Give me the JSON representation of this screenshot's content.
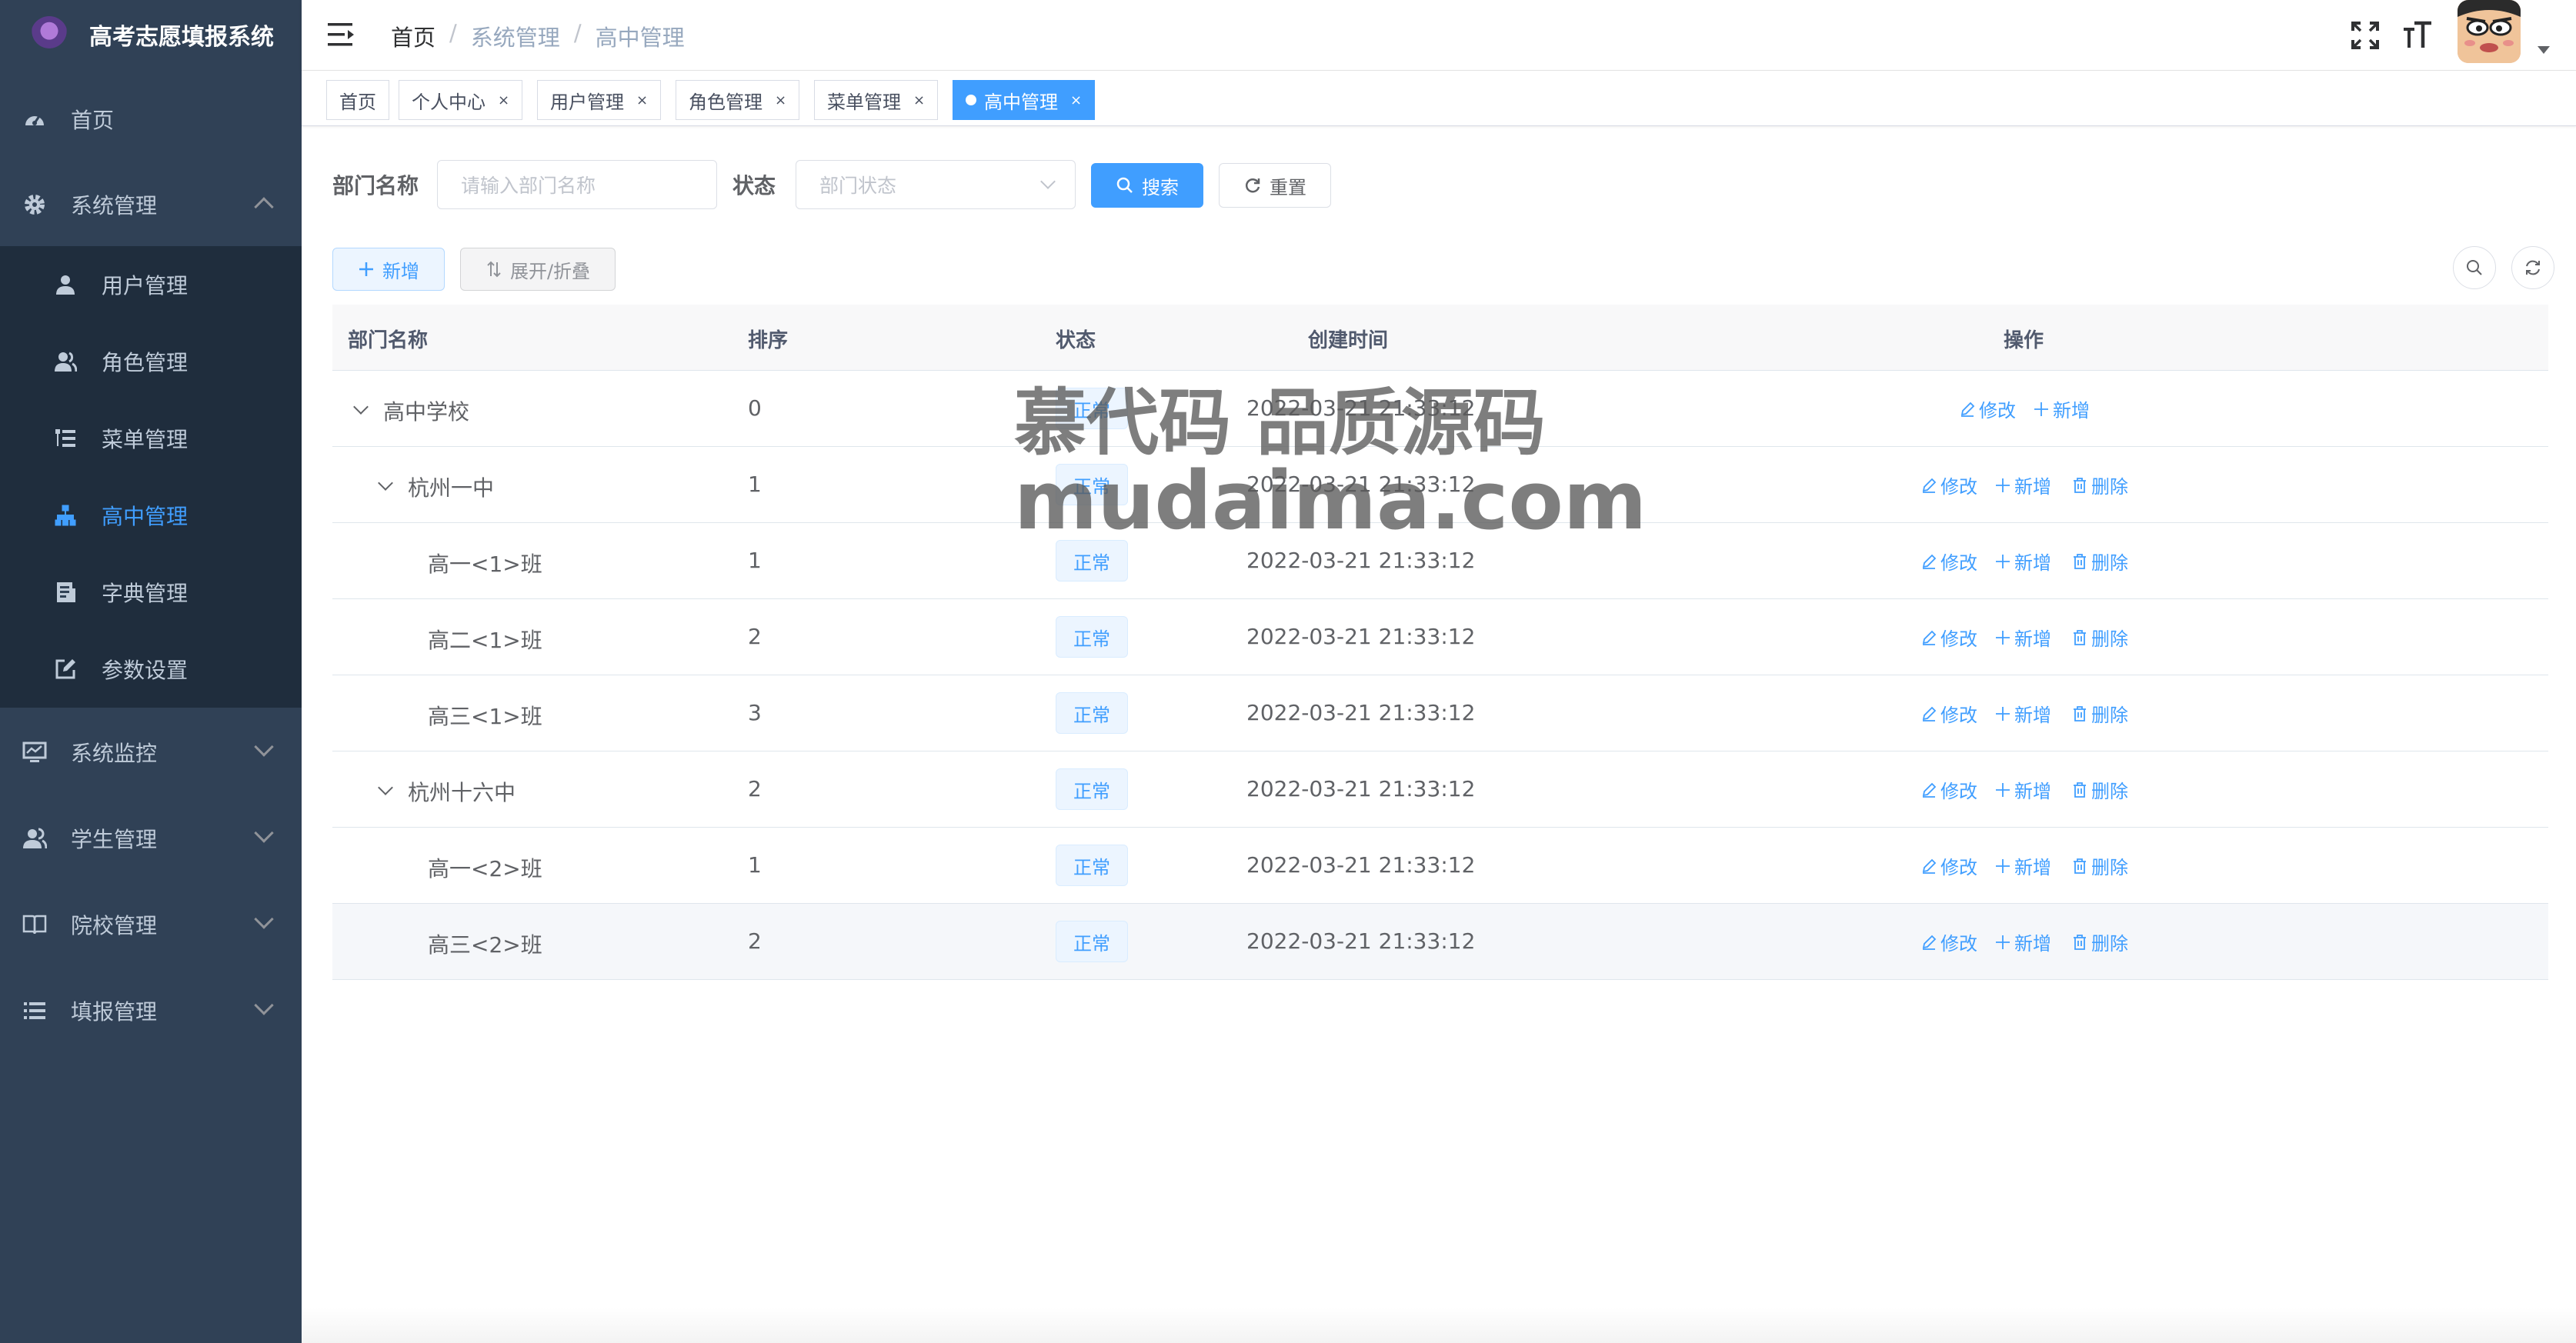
{
  "app": {
    "title": "高考志愿填报系统"
  },
  "sidebar": {
    "items": [
      {
        "label": "首页",
        "icon": "dashboard-icon"
      },
      {
        "label": "系统管理",
        "icon": "gear-icon",
        "expanded": true
      },
      {
        "label": "系统监控",
        "icon": "monitor-icon"
      },
      {
        "label": "学生管理",
        "icon": "users-icon"
      },
      {
        "label": "院校管理",
        "icon": "book-icon"
      },
      {
        "label": "填报管理",
        "icon": "list-icon"
      }
    ],
    "submenu": [
      {
        "label": "用户管理",
        "icon": "user-icon"
      },
      {
        "label": "角色管理",
        "icon": "role-icon"
      },
      {
        "label": "菜单管理",
        "icon": "tree-table-icon"
      },
      {
        "label": "高中管理",
        "icon": "org-tree-icon",
        "active": true
      },
      {
        "label": "字典管理",
        "icon": "dict-icon"
      },
      {
        "label": "参数设置",
        "icon": "edit-icon"
      }
    ]
  },
  "header": {
    "breadcrumb": [
      "首页",
      "系统管理",
      "高中管理"
    ],
    "separator": "/"
  },
  "tags": [
    {
      "label": "首页",
      "closable": false
    },
    {
      "label": "个人中心",
      "closable": true
    },
    {
      "label": "用户管理",
      "closable": true
    },
    {
      "label": "角色管理",
      "closable": true
    },
    {
      "label": "菜单管理",
      "closable": true
    },
    {
      "label": "高中管理",
      "closable": true,
      "active": true
    }
  ],
  "tag_close": "×",
  "search": {
    "name_label": "部门名称",
    "name_placeholder": "请输入部门名称",
    "status_label": "状态",
    "status_placeholder": "部门状态",
    "search_button": "搜索",
    "reset_button": "重置"
  },
  "toolbar": {
    "add_button": "新增",
    "toggle_button": "展开/折叠"
  },
  "table": {
    "columns": [
      "部门名称",
      "排序",
      "状态",
      "创建时间",
      "操作"
    ],
    "rows": [
      {
        "name": "高中学校",
        "sort": "0",
        "status": "正常",
        "created": "2022-03-21 21:33:12",
        "level": 0,
        "expandable": true,
        "deletable": false
      },
      {
        "name": "杭州一中",
        "sort": "1",
        "status": "正常",
        "created": "2022-03-21 21:33:12",
        "level": 1,
        "expandable": true,
        "deletable": true
      },
      {
        "name": "高一<1>班",
        "sort": "1",
        "status": "正常",
        "created": "2022-03-21 21:33:12",
        "level": 2,
        "expandable": false,
        "deletable": true
      },
      {
        "name": "高二<1>班",
        "sort": "2",
        "status": "正常",
        "created": "2022-03-21 21:33:12",
        "level": 2,
        "expandable": false,
        "deletable": true
      },
      {
        "name": "高三<1>班",
        "sort": "3",
        "status": "正常",
        "created": "2022-03-21 21:33:12",
        "level": 2,
        "expandable": false,
        "deletable": true
      },
      {
        "name": "杭州十六中",
        "sort": "2",
        "status": "正常",
        "created": "2022-03-21 21:33:12",
        "level": 1,
        "expandable": true,
        "deletable": true
      },
      {
        "name": "高一<2>班",
        "sort": "1",
        "status": "正常",
        "created": "2022-03-21 21:33:12",
        "level": 2,
        "expandable": false,
        "deletable": true
      },
      {
        "name": "高三<2>班",
        "sort": "2",
        "status": "正常",
        "created": "2022-03-21 21:33:12",
        "level": 2,
        "expandable": false,
        "deletable": true
      }
    ],
    "actions": {
      "edit": "修改",
      "add": "新增",
      "delete": "删除"
    }
  },
  "watermark": {
    "line1": "慕代码 品质源码",
    "line2": "mudaima.com"
  },
  "colors": {
    "sidebar_bg": "#304156",
    "submenu_bg": "#1f2d3d",
    "primary": "#409eff",
    "sidebar_text": "#bfcbd9"
  }
}
